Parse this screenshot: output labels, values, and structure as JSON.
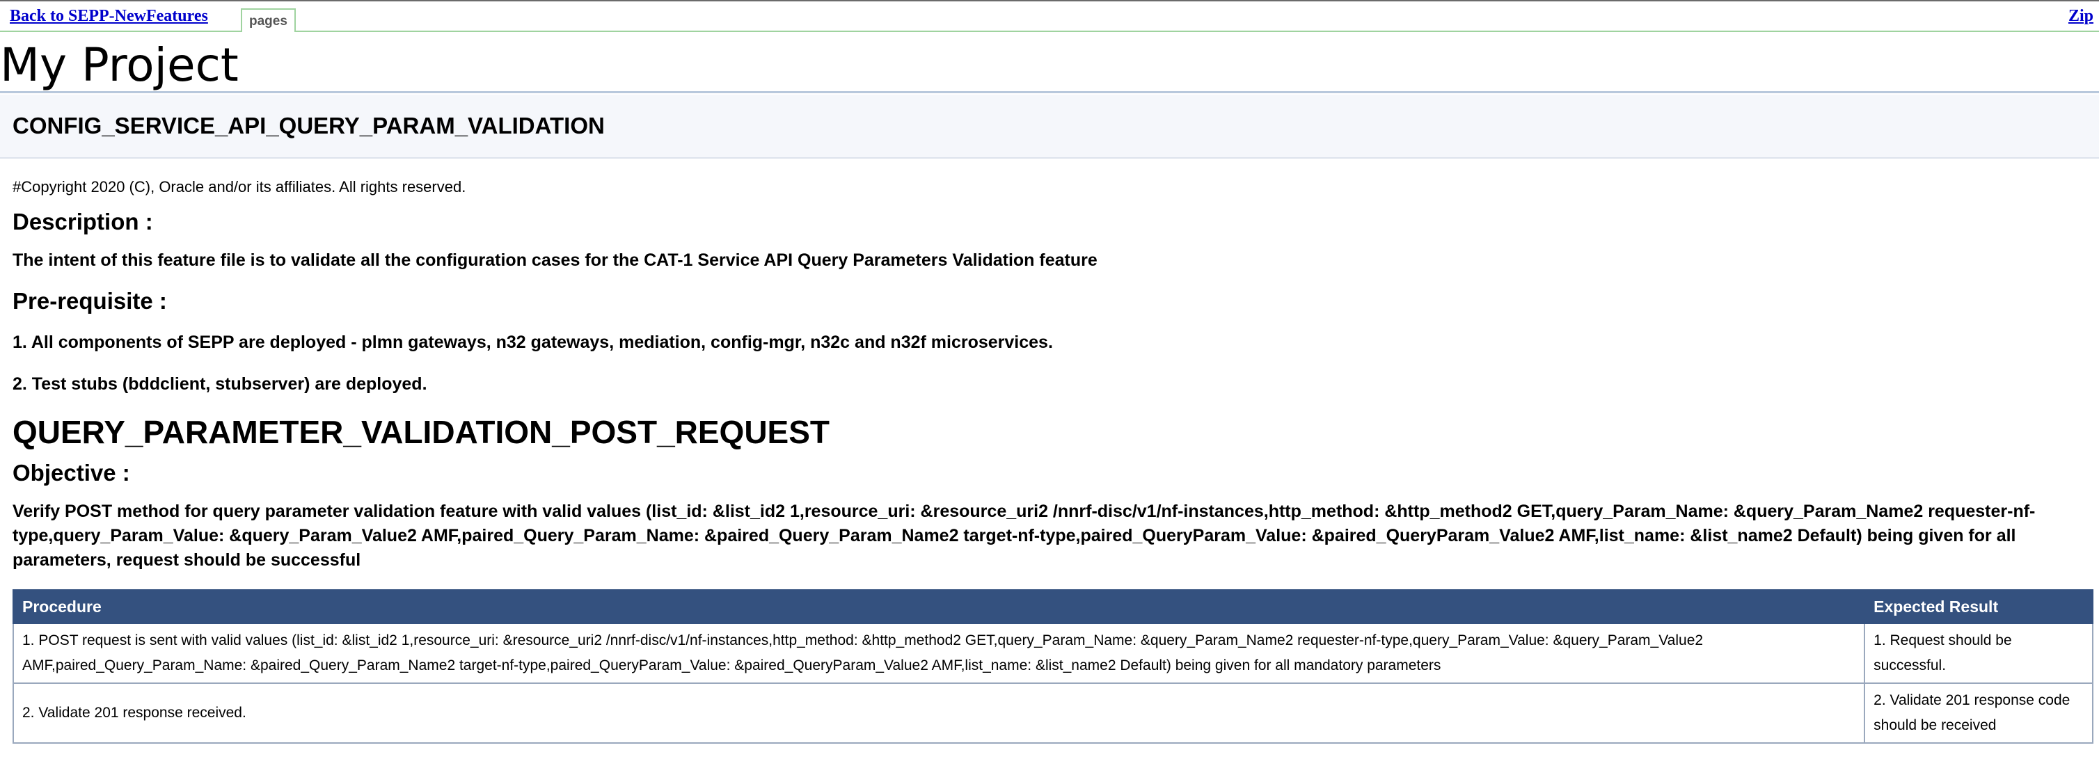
{
  "header": {
    "back_link": "Back to SEPP-NewFeatures",
    "tab_label": "pages",
    "zip_link": "Zip"
  },
  "project_title": "My Project",
  "feature": {
    "title": "CONFIG_SERVICE_API_QUERY_PARAM_VALIDATION",
    "copyright": "#Copyright 2020 (C), Oracle and/or its affiliates. All rights reserved.",
    "description_heading": "Description :",
    "description_text": "The intent of this feature file is to validate all the configuration cases for the CAT-1 Service API Query Parameters Validation feature",
    "prerequisite_heading": "Pre-requisite :",
    "prerequisites": [
      "1. All components of SEPP are deployed - plmn gateways, n32 gateways, mediation, config-mgr, n32c and n32f microservices.",
      "2. Test stubs (bddclient, stubserver) are deployed."
    ]
  },
  "scenario": {
    "title": "QUERY_PARAMETER_VALIDATION_POST_REQUEST",
    "objective_heading": "Objective :",
    "objective_text": "Verify POST method for query parameter validation feature with valid values (list_id: &list_id2 1,resource_uri: &resource_uri2 /nnrf-disc/v1/nf-instances,http_method: &http_method2 GET,query_Param_Name: &query_Param_Name2 requester-nf-type,query_Param_Value: &query_Param_Value2 AMF,paired_Query_Param_Name: &paired_Query_Param_Name2 target-nf-type,paired_QueryParam_Value: &paired_QueryParam_Value2 AMF,list_name: &list_name2 Default) being given for all parameters, request should be successful",
    "table": {
      "headers": [
        "Procedure",
        "Expected Result"
      ],
      "rows": [
        {
          "procedure": "1. POST request is sent with valid values (list_id: &list_id2 1,resource_uri: &resource_uri2 /nnrf-disc/v1/nf-instances,http_method: &http_method2 GET,query_Param_Name: &query_Param_Name2 requester-nf-type,query_Param_Value: &query_Param_Value2 AMF,paired_Query_Param_Name: &paired_Query_Param_Name2 target-nf-type,paired_QueryParam_Value: &paired_QueryParam_Value2 AMF,list_name: &list_name2 Default) being given for all mandatory parameters",
          "expected": "1. Request should be successful."
        },
        {
          "procedure": "2. Validate 201 response received.",
          "expected": "2. Validate 201 response code should be received"
        }
      ]
    }
  },
  "colors": {
    "link": "#0000cc",
    "table_header_bg": "#34517f",
    "tab_border": "#9fd39f",
    "feature_band_bg": "#f5f7fb"
  }
}
